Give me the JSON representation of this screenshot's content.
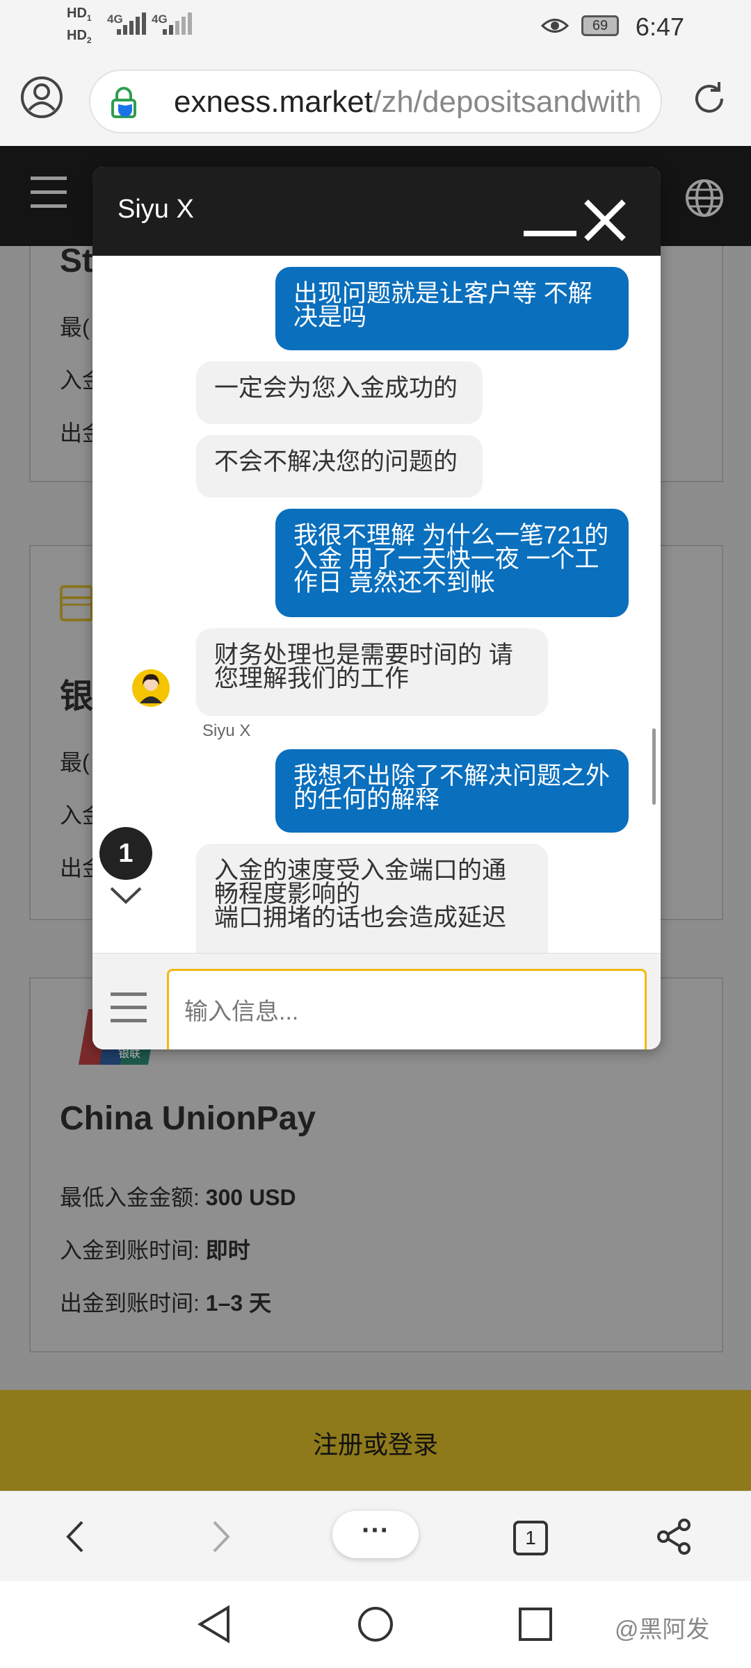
{
  "status_bar": {
    "hd1": "HD",
    "hd1_sub": "1",
    "hd2": "HD",
    "hd2_sub": "2",
    "net1": "4G",
    "net2": "4G",
    "battery": "69",
    "time": "6:47"
  },
  "browser": {
    "url_host": "exness.market",
    "url_path": "/zh/depositsandwith"
  },
  "page": {
    "card_top": {
      "title_fragment": "St",
      "lines": [
        "最(",
        "入金",
        "出金"
      ]
    },
    "card_bank": {
      "title_fragment": "银",
      "lines": [
        "最(",
        "入金",
        "出金"
      ]
    },
    "card_cup": {
      "logo_text": "银联",
      "title": "China UnionPay",
      "min_deposit_label": "最低入金金额: ",
      "min_deposit_value": "300 USD",
      "deposit_time_label": "入金到账时间: ",
      "deposit_time_value": "即时",
      "withdraw_time_label": "出金到账时间: ",
      "withdraw_time_value": "1–3 天"
    },
    "cta_label": "注册或登录"
  },
  "chat": {
    "agent_name": "Siyu X",
    "agent_label": "Siyu X",
    "messages": [
      {
        "dir": "out",
        "text": "出现问题就是让客户等 不解决是吗"
      },
      {
        "dir": "in",
        "text": "一定会为您入金成功的"
      },
      {
        "dir": "in",
        "text": "不会不解决您的问题的"
      },
      {
        "dir": "out",
        "text": "我很不理解 为什么一笔721的入金 用了一天快一夜 一个工作日 竟然还不到帐"
      },
      {
        "dir": "in",
        "text": "财务处理也是需要时间的  请您理解我们的工作"
      },
      {
        "dir": "out",
        "text": "我想不出除了不解决问题之外的任何的解释"
      },
      {
        "dir": "in",
        "text": "入金的速度受入金端口的通畅程度影响的\n端口拥堵的话也会造成延迟"
      }
    ],
    "unread_count": "1",
    "input_placeholder": "输入信息..."
  },
  "toolbar": {
    "more_label": "···",
    "tab_count": "1"
  },
  "watermark": "@黑阿发",
  "colors": {
    "accent_blue": "#0a6fbd",
    "input_border": "#f0b90b",
    "cta_bg": "#8e7a1a"
  }
}
